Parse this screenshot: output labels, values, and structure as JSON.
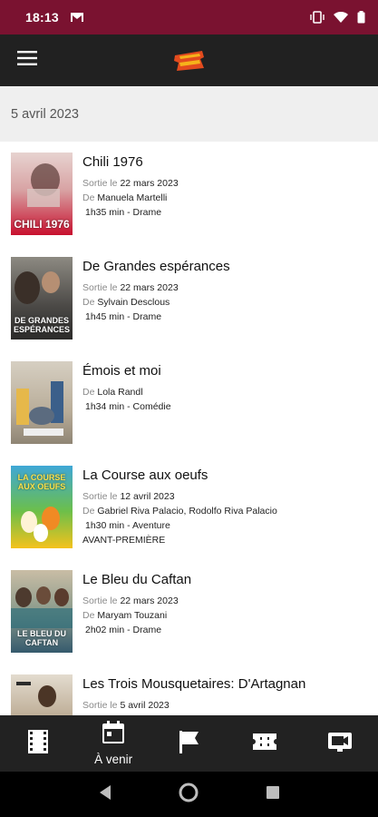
{
  "status": {
    "time": "18:13"
  },
  "date_header": "5 avril 2023",
  "labels": {
    "sortie": "Sortie le",
    "de": "De"
  },
  "movies": [
    {
      "title": "Chili 1976",
      "release": "22 mars 2023",
      "director": "Manuela Martelli",
      "meta": "1h35 min - Drame",
      "tag": "",
      "poster_text": "CHILI 1976",
      "poster_colors": [
        "#e7d3d0",
        "#c8102e"
      ]
    },
    {
      "title": "De Grandes espérances",
      "release": "22 mars 2023",
      "director": "Sylvain Desclous",
      "meta": "1h45 min - Drame",
      "tag": "",
      "poster_text": "DE GRANDES ESPÉRANCES",
      "poster_colors": [
        "#6c6a64",
        "#2c2b2a"
      ]
    },
    {
      "title": "Émois et moi",
      "release": "",
      "director": "Lola Randl",
      "meta": "1h34 min - Comédie",
      "tag": "",
      "poster_text": "",
      "poster_colors": [
        "#c9c1b2",
        "#7b7366"
      ]
    },
    {
      "title": "La Course aux oeufs",
      "release": "12 avril 2023",
      "director": "Gabriel Riva Palacio, Rodolfo Riva Palacio",
      "meta": "1h30 min - Aventure",
      "tag": "AVANT-PREMIÈRE",
      "poster_text": "LA COURSE AUX OEUFS",
      "poster_colors": [
        "#3fa7d6",
        "#f4c21c"
      ]
    },
    {
      "title": "Le Bleu du Caftan",
      "release": "22 mars 2023",
      "director": "Maryam Touzani",
      "meta": "2h02 min - Drame",
      "tag": "",
      "poster_text": "LE BLEU DU CAFTAN",
      "poster_colors": [
        "#b9a98c",
        "#355a6d"
      ]
    },
    {
      "title": "Les Trois Mousquetaires: D'Artagnan",
      "release": "5 avril 2023",
      "director": "",
      "meta": "",
      "tag": "",
      "poster_text": "",
      "poster_colors": [
        "#d9d2c6",
        "#5c4b3a"
      ]
    }
  ],
  "bottom_nav": [
    {
      "icon": "film-icon",
      "label": ""
    },
    {
      "icon": "calendar-icon",
      "label": "À venir"
    },
    {
      "icon": "flag-icon",
      "label": ""
    },
    {
      "icon": "ticket-icon",
      "label": ""
    },
    {
      "icon": "video-icon",
      "label": ""
    }
  ],
  "colors": {
    "status_bar": "#7a1230",
    "app_bar": "#212121",
    "bottom_nav": "#222222",
    "accent": "#e34b1e"
  }
}
